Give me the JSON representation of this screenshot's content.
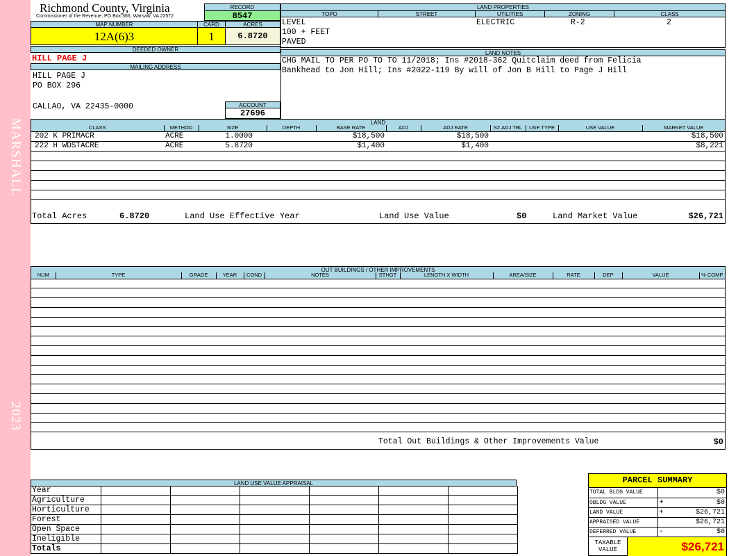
{
  "sidebar": {
    "district": "MARSHALL",
    "year": "2023"
  },
  "header": {
    "county": "Richmond County, Virginia",
    "commissioner": "Commissioner of the Revenue, PO Box 366, Warsaw, VA 22572",
    "record_label": "RECORD",
    "record_value": "8547",
    "map_number_label": "MAP NUMBER",
    "map_number": "12A(6)3",
    "card_label": "CARD",
    "card": "1",
    "acres_label": "ACRES",
    "acres": "6.8720"
  },
  "owner": {
    "deeded_owner_label": "DEEDED OWNER",
    "deeded_owner": "HILL PAGE J",
    "mailing_address_label": "MAILING ADDRESS",
    "address_line1": "HILL PAGE J",
    "address_line2": "PO BOX 296",
    "address_line3": "CALLAO, VA 22435-0000",
    "account_label": "ACCOUNT",
    "account": "27696"
  },
  "land_properties": {
    "title": "LAND PROPERTIES",
    "headers": {
      "topo": "TOPO",
      "street": "STREET",
      "utilities": "UTILITIES",
      "zoning": "ZONING",
      "class": "CLASS"
    },
    "topo": [
      "LEVEL",
      "100 + FEET",
      "PAVED"
    ],
    "utilities": "ELECTRIC",
    "zoning": "R-2",
    "class": "2"
  },
  "land_notes": {
    "title": "LAND NOTES",
    "line1": "CHG MAIL TO PER PO TO TO 11/2018; Ins #2018-362 Quitclaim deed from Felicia",
    "line2": "Bankhead to Jon Hill; Ins #2022-119 By will of Jon B Hill to Page J Hill"
  },
  "land": {
    "title": "LAND",
    "columns": [
      "CLASS",
      "METHOD",
      "SIZE",
      "DEPTH",
      "BASE RATE",
      "ADJ",
      "ADJ RATE",
      "SZ ADJ TBL",
      "USE TYPE",
      "USE VALUE",
      "MARKET VALUE"
    ],
    "rows": [
      {
        "class": "202 K PRIMACR",
        "method": "ACRE",
        "size": "1.0000",
        "depth": "",
        "base_rate": "$18,500",
        "adj": "",
        "adj_rate": "$18,500",
        "sz_adj_tbl": "",
        "use_type": "",
        "use_value": "",
        "market_value": "$18,500"
      },
      {
        "class": "222 H WDSTACRE",
        "method": "ACRE",
        "size": "5.8720",
        "depth": "",
        "base_rate": "$1,400",
        "adj": "",
        "adj_rate": "$1,400",
        "sz_adj_tbl": "",
        "use_type": "",
        "use_value": "",
        "market_value": "$8,221"
      }
    ],
    "total_acres_label": "Total Acres",
    "total_acres": "6.8720",
    "land_use_year_label": "Land Use Effective Year",
    "land_use_value_label": "Land Use Value",
    "land_use_value": "$0",
    "land_market_value_label": "Land Market Value",
    "land_market_value": "$26,721"
  },
  "outbuildings": {
    "title": "OUT BUILDINGS / OTHER IMPROVEMENTS",
    "columns": [
      "NUM",
      "TYPE",
      "GRADE",
      "YEAR",
      "COND",
      "NOTES",
      "STHGT",
      "LENGTH X WIDTH",
      "AREA/SIZE",
      "RATE",
      "DEP",
      "VALUE",
      "% COMP"
    ],
    "total_label": "Total Out Buildings & Other Improvements Value",
    "total_value": "$0"
  },
  "land_use_appraisal": {
    "title": "LAND USE VALUE APPRAISAL",
    "rows": [
      "Year",
      "Agriculture",
      "Horticulture",
      "Forest",
      "Open Space",
      "Ineligible",
      "Totals"
    ]
  },
  "parcel_summary": {
    "title": "PARCEL SUMMARY",
    "rows": [
      {
        "label": "TOTAL BLDG VALUE",
        "sign": "",
        "value": "$0"
      },
      {
        "label": "OBLDG VALUE",
        "sign": "+",
        "value": "$0"
      },
      {
        "label": "LAND VALUE",
        "sign": "+",
        "value": "$26,721"
      },
      {
        "label": "APPRAISED VALUE",
        "sign": "",
        "value": "$26,721"
      },
      {
        "label": "DEFERRED VALUE",
        "sign": "-",
        "value": "$0"
      }
    ],
    "taxable_label_line1": "TAXABLE",
    "taxable_label_line2": "VALUE",
    "taxable_value": "$26,721"
  },
  "colors": {
    "header_blue": "#add8e6",
    "sidebar_pink": "#ffc0cb",
    "yellow": "#ffff00",
    "record_green": "#90ee90",
    "owner_red": "#e00000"
  }
}
